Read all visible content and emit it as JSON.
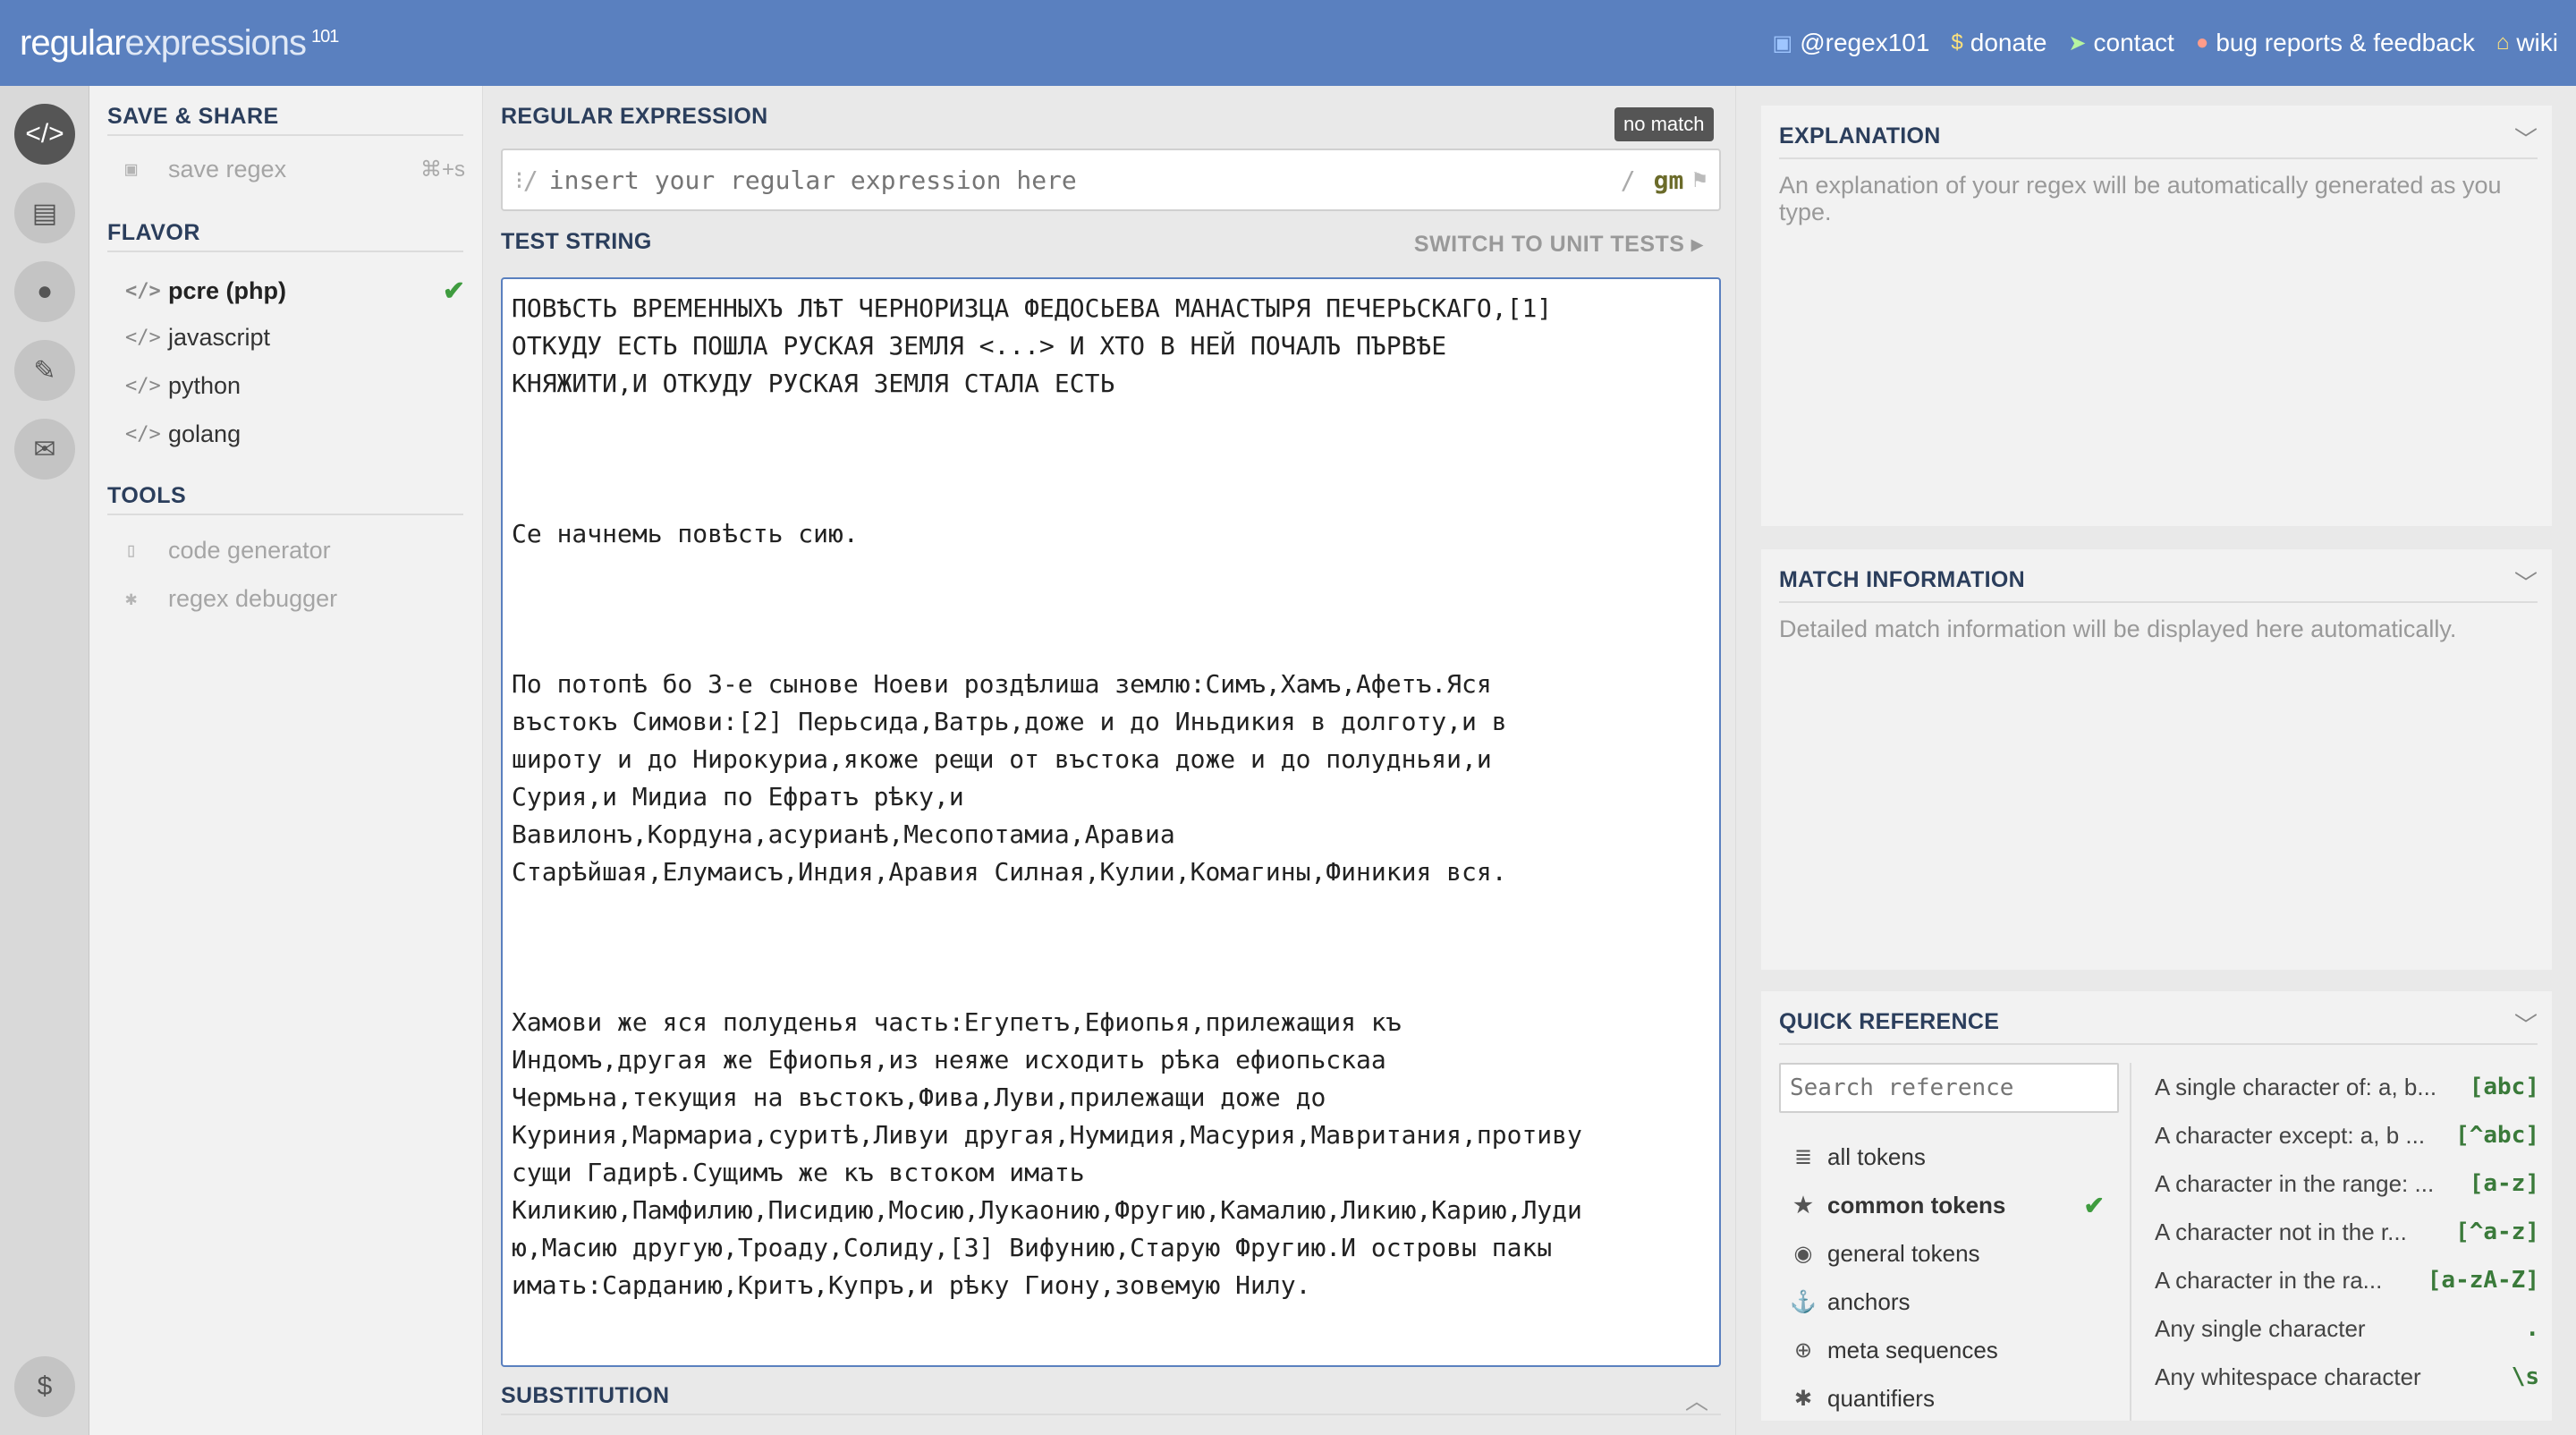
{
  "header": {
    "logo_main": "regular",
    "logo_light": "expressions",
    "logo_sup": "101",
    "links": [
      "@regex101",
      "donate",
      "contact",
      "bug reports & feedback",
      "wiki"
    ]
  },
  "sidebar": {
    "save_share_title": "SAVE & SHARE",
    "save_regex_label": "save regex",
    "save_regex_shortcut": "⌘+s",
    "flavor_title": "FLAVOR",
    "flavors": [
      "pcre (php)",
      "javascript",
      "python",
      "golang"
    ],
    "selected_flavor": "pcre (php)",
    "tools_title": "TOOLS",
    "tools": [
      "code generator",
      "regex debugger"
    ]
  },
  "regex": {
    "title": "REGULAR EXPRESSION",
    "status": "no match",
    "open_delim": "/",
    "close_delim": "/",
    "placeholder": "insert your regular expression here",
    "value": "",
    "flags": "gm"
  },
  "test": {
    "title": "TEST STRING",
    "switch_label": "SWITCH TO UNIT TESTS",
    "text": "ПОВѢСТЬ ВРЕМЕННЫХЪ ЛѢТ ЧЕРНОРИЗЦА ФЕДОСЬЕВА МАНАСТЫРЯ ПЕЧЕРЬСКАГО,[1]\nОТКУДУ ЕСТЬ ПОШЛА РУСКАЯ ЗЕМЛЯ <...> И ХТО В НЕЙ ПОЧАЛЪ ПЪРВѢЕ\nКНЯЖИТИ,И ОТКУДУ РУСКАЯ ЗЕМЛЯ СТАЛА ЕСТЬ\n\n\n\nСе начнемь повѣсть сию.\n\n\n\nПо потопѣ бо 3-е сынове Ноеви роздѣлиша землю:Симъ,Хамъ,Афетъ.Яся\nвъстокъ Симови:[2] Перьсида,Ватрь,доже и до Иньдикия в долготу,и в\nшироту и до Нирокуриа,якоже рещи от въстока доже и до полудньяи,и\nСурия,и Мидиа по Ефратъ рѣку,и\nВавилонъ,Кордуна,асурианѣ,Месопотамиа,Аравиа\nСтарѣйшая,Елумаисъ,Индия,Аравия Силная,Кулии,Комагины,Финикия вся.\n\n\n\nХамови же яся полуденья часть:Егупетъ,Ефиопья,прилежащия къ\nИндомъ,другая же Ефиопья,из неяже исходить рѣка ефиопьскаа\nЧермьна,текущия на въстокъ,Фива,Луви,прилежащи доже до\nКуриния,Мармариа,суритѣ,Ливуи другая,Нумидия,Масурия,Мавритания,противу\nсущи Гадирѣ.Сущимъ же къ встоком имать\nКиликию,Памфилию,Писидию,Мосию,Лукаонию,Фругию,Камалию,Ликию,Карию,Луди\nю,Масию другую,Троаду,Солиду,[3] Вифунию,Старую Фругию.И островы пакы\nимать:Сарданию,Критъ,Купръ,и рѣку Гиону,зовемую Нилу."
  },
  "substitution": {
    "title": "SUBSTITUTION"
  },
  "explanation": {
    "title": "EXPLANATION",
    "text": "An explanation of your regex will be automatically generated as you type."
  },
  "match_info": {
    "title": "MATCH INFORMATION",
    "text": "Detailed match information will be displayed here automatically."
  },
  "quick_ref": {
    "title": "QUICK REFERENCE",
    "search_placeholder": "Search reference",
    "categories": [
      "all tokens",
      "common tokens",
      "general tokens",
      "anchors",
      "meta sequences",
      "quantifiers"
    ],
    "selected_category": "common tokens",
    "items": [
      {
        "desc": "A single character of: a, b...",
        "token": "[abc]"
      },
      {
        "desc": "A character except: a, b ...",
        "token": "[^abc]"
      },
      {
        "desc": "A character in the range: ...",
        "token": "[a-z]"
      },
      {
        "desc": "A character not in the r...",
        "token": "[^a-z]"
      },
      {
        "desc": "A character in the ra...",
        "token": "[a-zA-Z]"
      },
      {
        "desc": "Any single character",
        "token": "."
      },
      {
        "desc": "Any whitespace character",
        "token": "\\s"
      }
    ]
  },
  "colors": {
    "header": "#5a80bf",
    "accent_green": "#3f9c3f",
    "title": "#2b3e5c"
  }
}
